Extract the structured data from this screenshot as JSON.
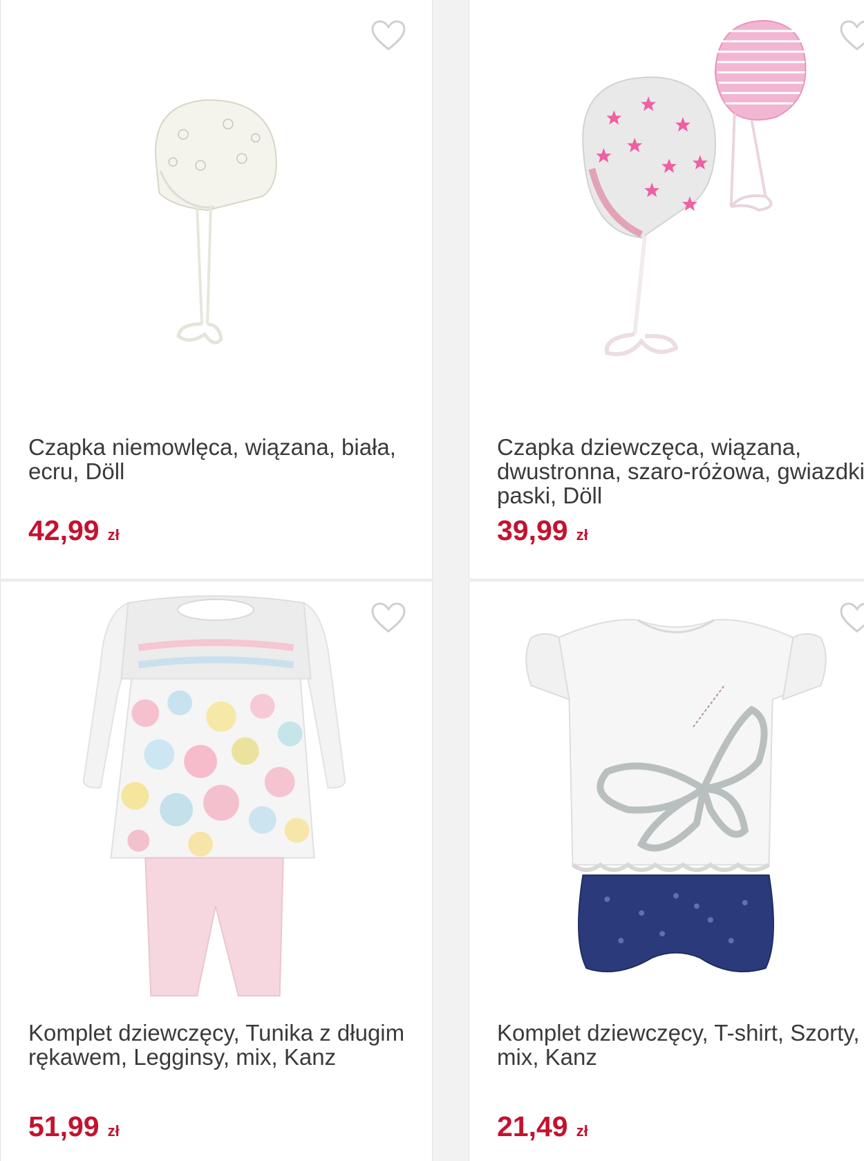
{
  "products": [
    {
      "title": "Czapka niemowlęca, wiązana, biała, ecru, Döll",
      "price": "42,99",
      "currency": "zł",
      "favorite_icon": "heart-outline-icon"
    },
    {
      "title": "Czapka dziewczęca, wiązana, dwustronna, szaro-różowa, gwiazdki, paski, Döll",
      "price": "39,99",
      "currency": "zł",
      "favorite_icon": "heart-outline-icon"
    },
    {
      "title": "Komplet dziewczęcy, Tunika z długim rękawem, Legginsy, mix, Kanz",
      "price": "51,99",
      "currency": "zł",
      "favorite_icon": "heart-outline-icon"
    },
    {
      "title": "Komplet dziewczęcy, T-shirt, Szorty, mix, Kanz",
      "price": "21,49",
      "currency": "zł",
      "favorite_icon": "heart-outline-icon"
    }
  ],
  "colors": {
    "price": "#c4122f",
    "text": "#3a3a3a",
    "border": "#e2e2e2"
  }
}
